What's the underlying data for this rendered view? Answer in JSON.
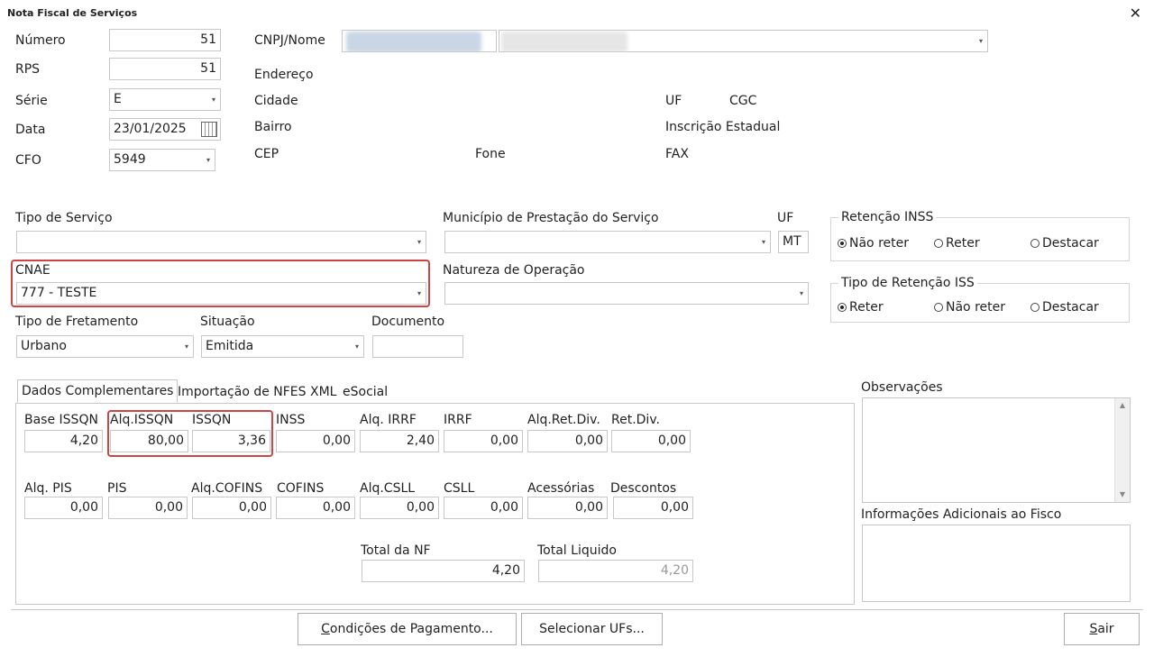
{
  "window": {
    "title": "Nota Fiscal de Serviços",
    "close_glyph": "✕"
  },
  "header": {
    "numero_label": "Número",
    "numero_value": "51",
    "rps_label": "RPS",
    "rps_value": "51",
    "serie_label": "Série",
    "serie_value": "E",
    "data_label": "Data",
    "data_value": "23/01/2025",
    "cfo_label": "CFO",
    "cfo_value": "5949",
    "cnpj_label": "CNPJ/Nome",
    "endereco_label": "Endereço",
    "cidade_label": "Cidade",
    "uf_label": "UF",
    "cgc_label": "CGC",
    "bairro_label": "Bairro",
    "ie_label": "Inscrição Estadual",
    "cep_label": "CEP",
    "fone_label": "Fone",
    "fax_label": "FAX"
  },
  "service": {
    "tipo_servico_label": "Tipo de Serviço",
    "tipo_servico_value": "",
    "municipio_label": "Município de Prestação do Serviço",
    "municipio_value": "",
    "uf_label": "UF",
    "uf_value": "MT",
    "cnae_label": "CNAE",
    "cnae_value": "777 - TESTE",
    "natureza_label": "Natureza de Operação",
    "natureza_value": "",
    "fretamento_label": "Tipo de Fretamento",
    "fretamento_value": "Urbano",
    "situacao_label": "Situação",
    "situacao_value": "Emitida",
    "documento_label": "Documento",
    "documento_value": ""
  },
  "retencao_inss": {
    "legend": "Retenção INSS",
    "options": [
      "Não reter",
      "Reter",
      "Destacar"
    ],
    "selected": "Não reter"
  },
  "retencao_iss": {
    "legend": "Tipo de Retenção ISS",
    "options": [
      "Reter",
      "Não reter",
      "Destacar"
    ],
    "selected": "Reter"
  },
  "tabs": [
    "Dados Complementares",
    "Importação de NFES XML",
    "eSocial"
  ],
  "active_tab": "Dados Complementares",
  "complementares": {
    "row1": [
      {
        "label": "Base ISSQN",
        "value": "4,20"
      },
      {
        "label": "Alq.ISSQN",
        "value": "80,00"
      },
      {
        "label": "ISSQN",
        "value": "3,36"
      },
      {
        "label": "INSS",
        "value": "0,00"
      },
      {
        "label": "Alq. IRRF",
        "value": "2,40"
      },
      {
        "label": "IRRF",
        "value": "0,00"
      },
      {
        "label": "Alq.Ret.Div.",
        "value": "0,00"
      },
      {
        "label": "Ret.Div.",
        "value": "0,00"
      }
    ],
    "row2": [
      {
        "label": "Alq. PIS",
        "value": "0,00"
      },
      {
        "label": "PIS",
        "value": "0,00"
      },
      {
        "label": "Alq.COFINS",
        "value": "0,00"
      },
      {
        "label": "COFINS",
        "value": "0,00"
      },
      {
        "label": "Alq.CSLL",
        "value": "0,00"
      },
      {
        "label": "CSLL",
        "value": "0,00"
      },
      {
        "label": "Acessórias",
        "value": "0,00"
      },
      {
        "label": "Descontos",
        "value": "0,00"
      }
    ],
    "total_nf_label": "Total da NF",
    "total_nf_value": "4,20",
    "total_liquido_label": "Total Liquido",
    "total_liquido_value": "4,20"
  },
  "observacoes_label": "Observações",
  "info_fisco_label": "Informações Adicionais ao Fisco",
  "buttons": {
    "condicoes_mnemonic": "C",
    "condicoes_rest": "ondições de Pagamento...",
    "selecionar": "Selecionar UFs...",
    "sair_mnemonic": "S",
    "sair_rest": "air"
  },
  "colors": {
    "highlight_border": "#d04444",
    "field_border": "#c8c8c8",
    "disabled_text": "#999999"
  },
  "icons": {
    "dropdown": "▾",
    "calendar": "calendar-icon",
    "scroll_up": "▲",
    "scroll_down": "▼"
  }
}
